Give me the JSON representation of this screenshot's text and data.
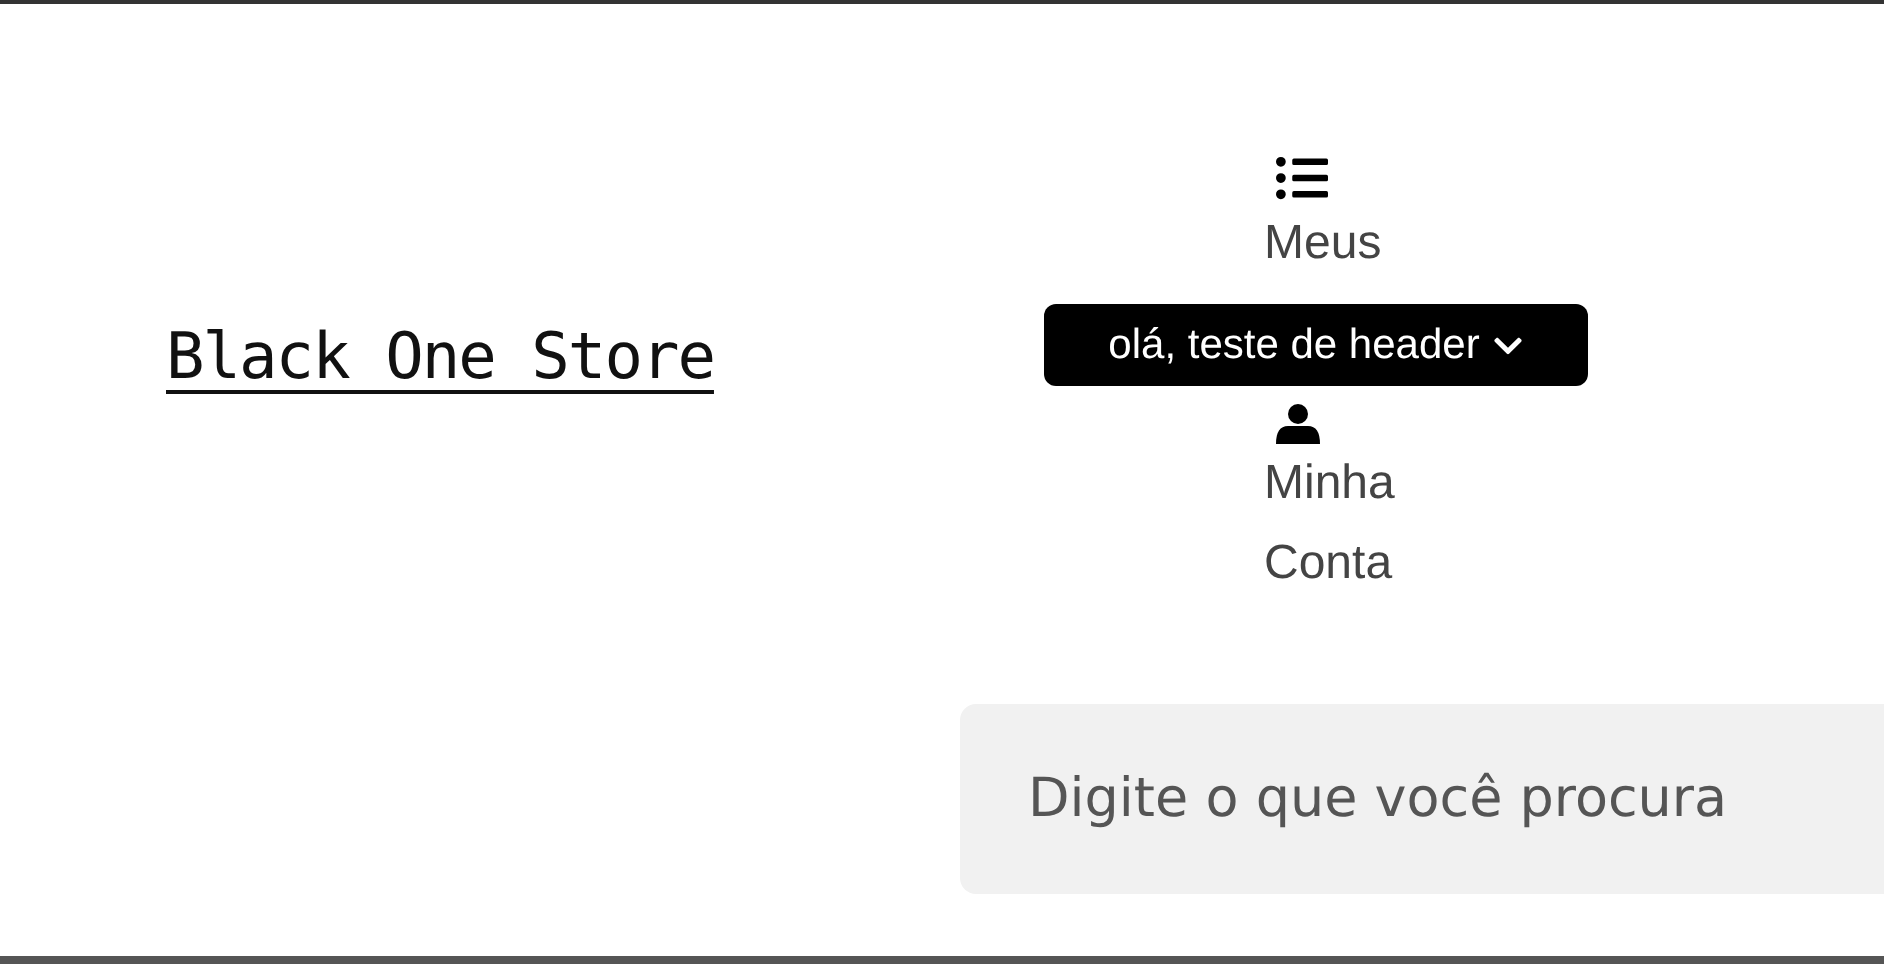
{
  "logo": {
    "text": "Black One Store"
  },
  "nav": [
    {
      "kind": "orders",
      "lines": [
        "Meus"
      ]
    },
    {
      "kind": "account",
      "lines": [
        "Minha",
        "Conta"
      ]
    }
  ],
  "user_menu": {
    "label": "olá, teste de header"
  },
  "search": {
    "placeholder": "Digite o que você procura"
  }
}
